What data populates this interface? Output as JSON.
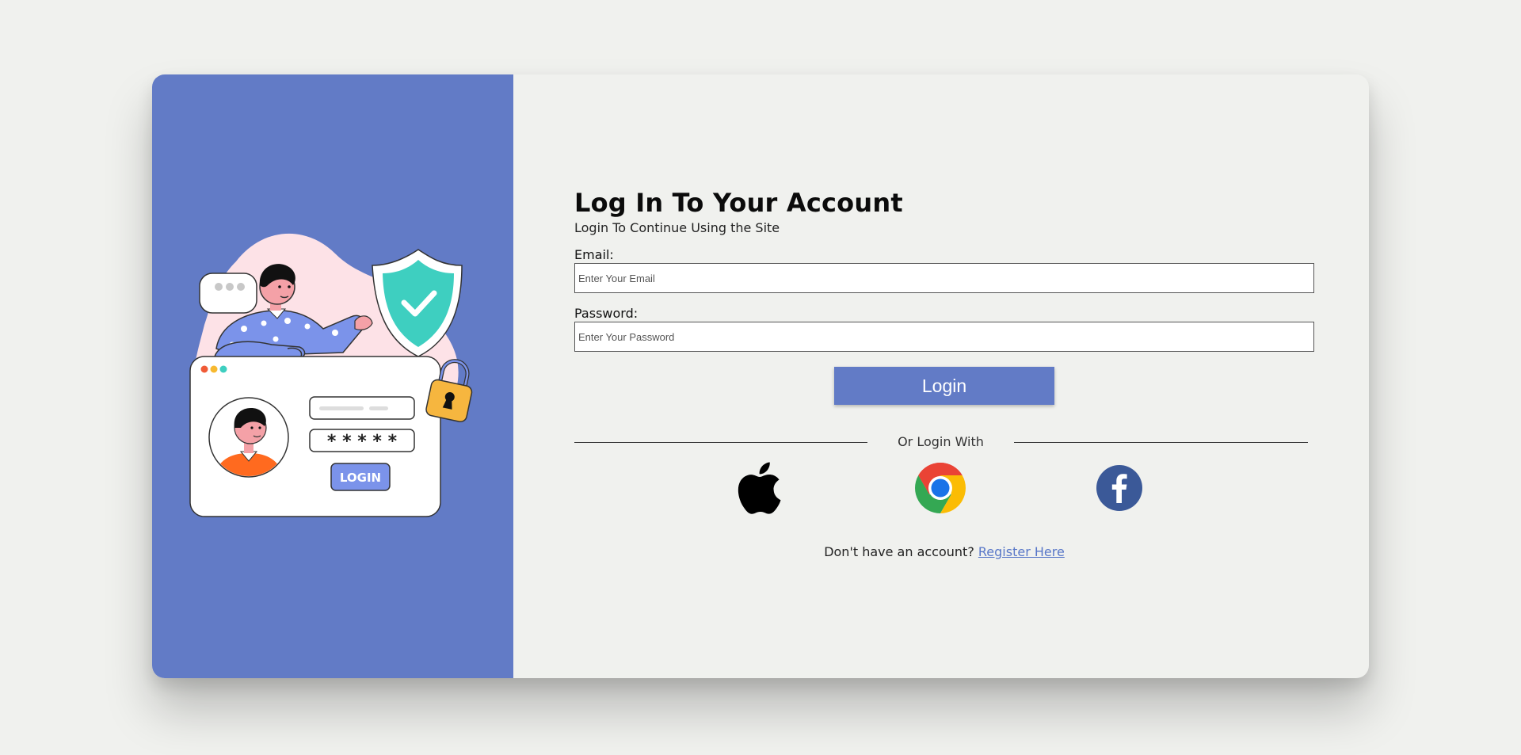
{
  "form": {
    "title": "Log In To Your Account",
    "subtitle": "Login To Continue Using the Site",
    "email_label": "Email:",
    "email_placeholder": "Enter Your Email",
    "email_value": "",
    "password_label": "Password:",
    "password_placeholder": "Enter Your Password",
    "password_value": "",
    "login_button": "Login",
    "divider_text": "Or Login With",
    "register_prompt": "Don't have an account?",
    "register_link": "Register Here"
  },
  "illustration": {
    "login_label": "LOGIN",
    "password_mask": "* * * * *"
  },
  "social": [
    "apple-icon",
    "chrome-icon",
    "facebook-icon"
  ],
  "colors": {
    "accent": "#627bc6",
    "background": "#f0f1ee",
    "link": "#5877c8",
    "shield": "#3ecfc0",
    "lock": "#f6b63f",
    "shirt": "#ff6a1f"
  }
}
